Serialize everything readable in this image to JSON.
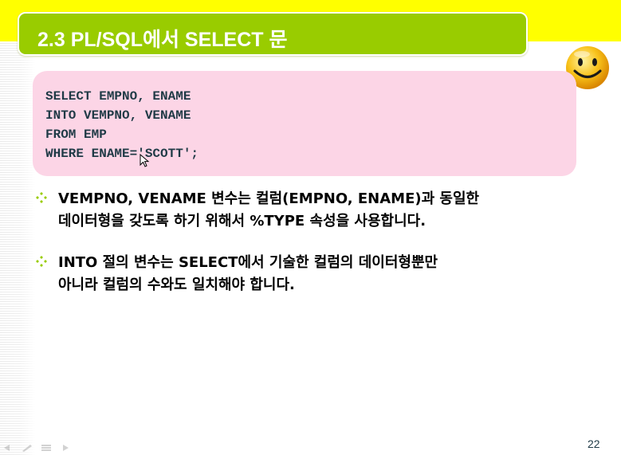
{
  "slide": {
    "title": "2.3 PL/SQL에서 SELECT 문",
    "page_number": "22"
  },
  "code_block": {
    "lines": [
      "SELECT EMPNO, ENAME",
      "INTO VEMPNO, VENAME",
      "FROM EMP",
      "WHERE ENAME='SCOTT';"
    ]
  },
  "bullets": [
    {
      "lines": [
        "VEMPNO, VENAME 변수는 컬럼(EMPNO, ENAME)과 동일한",
        "데이터형을 갖도록 하기 위해서 %TYPE 속성을 사용합니다."
      ]
    },
    {
      "lines": [
        "INTO 절의 변수는 SELECT에서 기술한 컬럼의 데이터형뿐만",
        "아니라 컬럼의 수와도 일치해야 합니다."
      ]
    }
  ],
  "icons": {
    "smiley": "smiley-face-icon",
    "bullet": "four-diamond-bullet-icon",
    "cursor": "mouse-pointer-icon"
  },
  "colors": {
    "top_band": "#ffff00",
    "title_bar": "#99cc00",
    "code_box": "#fcd5e6",
    "code_text": "#1f3a46",
    "bullet_icon": "#99cc00"
  }
}
